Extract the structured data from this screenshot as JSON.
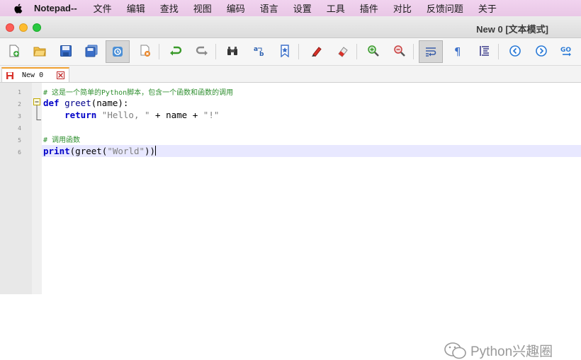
{
  "menubar": {
    "apple_icon": "apple-logo-icon",
    "app_name": "Notepad--",
    "items": [
      "文件",
      "编辑",
      "查找",
      "视图",
      "编码",
      "语言",
      "设置",
      "工具",
      "插件",
      "对比",
      "反馈问题",
      "关于"
    ]
  },
  "window": {
    "title": "New 0 [文本模式]"
  },
  "toolbar": {
    "buttons": [
      "new-file",
      "open-file",
      "save",
      "save-all",
      "close",
      "close-all",
      "undo",
      "redo",
      "find",
      "replace",
      "bookmark",
      "mark",
      "clear-mark",
      "zoom-in",
      "zoom-out",
      "word-wrap",
      "show-symbols",
      "indent-guide",
      "prev",
      "next",
      "goto"
    ]
  },
  "tab": {
    "label": "New 0"
  },
  "editor": {
    "line_numbers": [
      "1",
      "2",
      "3",
      "4",
      "5",
      "6"
    ],
    "lines": {
      "l1": "# 这是一个简单的Python脚本，包含一个函数和函数的调用",
      "l2_kw": "def",
      "l2_fn": "greet",
      "l2_rest": "(name):",
      "l3_indent": "    ",
      "l3_kw": "return",
      "l3_str1": "\"Hello, \"",
      "l3_mid": " + name + ",
      "l3_str2": "\"!\"",
      "l5": "# 调用函数",
      "l6_kw": "print",
      "l6_a": "(greet(",
      "l6_str": "\"World\"",
      "l6_b": "))"
    }
  },
  "watermark": {
    "text": "Python兴趣圈"
  },
  "colors": {
    "menubar": "#efcfec",
    "comment": "#2f8f2f",
    "keyword": "#0000c8",
    "string": "#808080",
    "current_line": "#e8e8ff"
  }
}
